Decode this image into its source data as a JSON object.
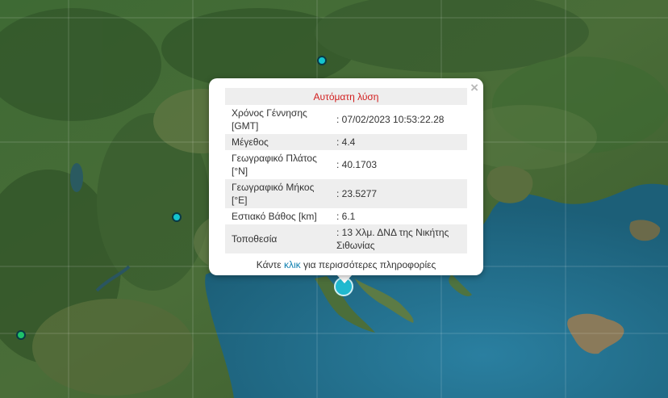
{
  "map": {
    "land_color": "#3b6332",
    "sea_color": "#1f6a84",
    "marker_color": "#14c4cf"
  },
  "popup": {
    "header": "Αυτόματη λύση",
    "close_symbol": "×",
    "rows": [
      {
        "label": "Χρόνος Γέννησης [GMT]",
        "value": ": 07/02/2023 10:53:22.28"
      },
      {
        "label": "Μέγεθος",
        "value": ": 4.4"
      },
      {
        "label": "Γεωγραφικό Πλάτος [°N]",
        "value": ": 40.1703"
      },
      {
        "label": "Γεωγραφικό Μήκος [°E]",
        "value": ": 23.5277"
      },
      {
        "label": "Εστιακό Βάθος [km]",
        "value": ": 6.1"
      },
      {
        "label": "Τοποθεσία",
        "value": ": 13 Χλμ. ΔΝΔ της Νικήτης Σιθωνίας"
      }
    ],
    "footer_prefix": "Κάντε",
    "footer_link": "κλικ",
    "footer_suffix": "για περισσότερες πληροφορίες"
  }
}
